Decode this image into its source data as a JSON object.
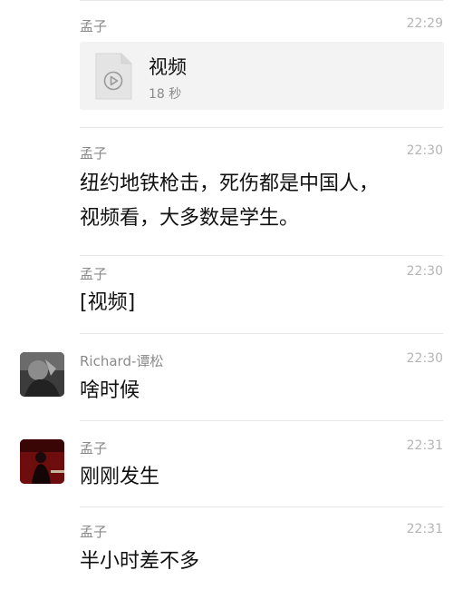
{
  "messages": [
    {
      "sender": "孟子",
      "time": "22:29",
      "type": "video_file",
      "file": {
        "name": "视频",
        "duration": "18 秒",
        "icon": "video-file-icon"
      }
    },
    {
      "sender": "孟子",
      "time": "22:30",
      "type": "text",
      "lines": [
        "纽约地铁枪击，死伤都是中国人，",
        "视频看，大多数是学生。"
      ]
    },
    {
      "sender": "孟子",
      "time": "22:30",
      "type": "text",
      "lines": [
        "[视频]"
      ]
    },
    {
      "sender": "Richard-谭松",
      "time": "22:30",
      "type": "text",
      "avatar": "avatar-dark-photo",
      "lines": [
        "啥时候"
      ]
    },
    {
      "sender": "孟子",
      "time": "22:31",
      "type": "text",
      "avatar": "avatar-red-photo",
      "lines": [
        "刚刚发生"
      ]
    },
    {
      "sender": "孟子",
      "time": "22:31",
      "type": "text",
      "lines": [
        "半小时差不多"
      ]
    }
  ],
  "colors": {
    "background": "#ffffff",
    "sender_text": "#8a8a8a",
    "time_text": "#b5b5b5",
    "message_text": "#111111",
    "divider": "#e6e6e6",
    "file_card_bg": "#f3f3f3"
  }
}
